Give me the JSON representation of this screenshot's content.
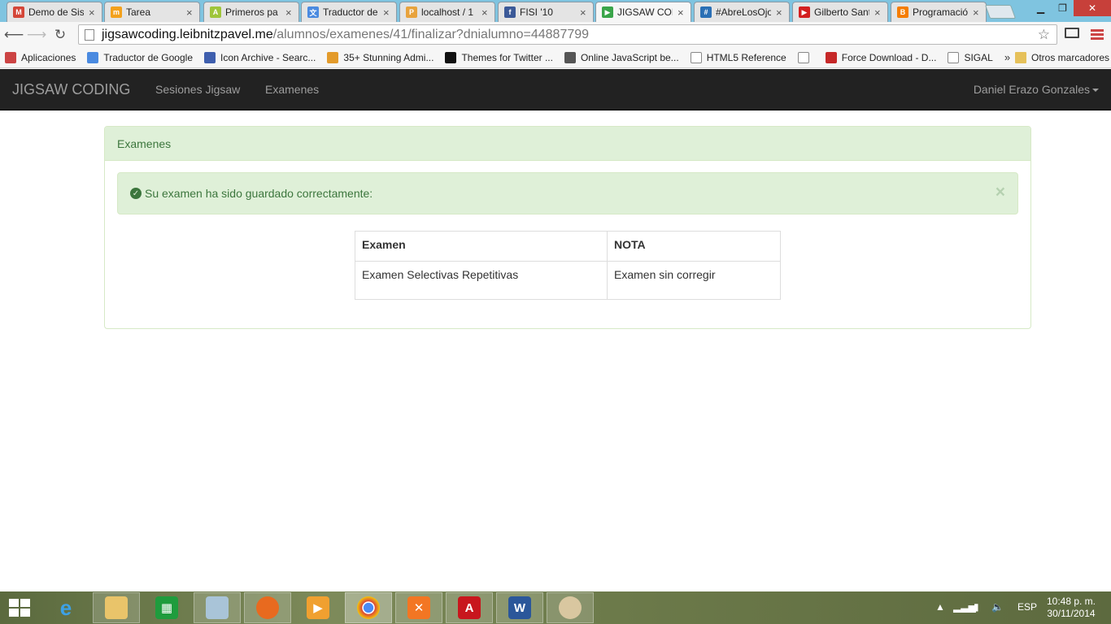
{
  "browser": {
    "tabs": [
      {
        "title": "Demo de Sis",
        "icon": "gmail-icon",
        "color": "#d44638",
        "glyph": "M"
      },
      {
        "title": "Tarea",
        "icon": "moodle-icon",
        "color": "#f3a11c",
        "glyph": "m"
      },
      {
        "title": "Primeros pa",
        "icon": "android-icon",
        "color": "#9fc53a",
        "glyph": "A"
      },
      {
        "title": "Traductor de",
        "icon": "translate-icon",
        "color": "#4a8ae0",
        "glyph": "文"
      },
      {
        "title": "localhost / 1",
        "icon": "phpmyadmin-icon",
        "color": "#e8a33d",
        "glyph": "P"
      },
      {
        "title": "FISI '10",
        "icon": "facebook-icon",
        "color": "#3b5998",
        "glyph": "f"
      },
      {
        "title": "JIGSAW COD",
        "icon": "play-icon",
        "color": "#3aa54a",
        "glyph": "▶"
      },
      {
        "title": "#AbreLosOjo",
        "icon": "web-icon",
        "color": "#2a6fb5",
        "glyph": "#"
      },
      {
        "title": "Gilberto Sant",
        "icon": "youtube-icon",
        "color": "#d32020",
        "glyph": "▶"
      },
      {
        "title": "Programació",
        "icon": "blogger-icon",
        "color": "#f57d00",
        "glyph": "B"
      }
    ],
    "active_tab_index": 6,
    "url": {
      "host": "jigsawcoding.leibnitzpavel.me",
      "path": "/alumnos/examenes/41/finalizar?dnialumno=44887799"
    },
    "bookmarks": [
      {
        "label": "Aplicaciones",
        "icon": "apps-grid-icon",
        "color": "#c44"
      },
      {
        "label": "Traductor de Google",
        "icon": "translate-icon",
        "color": "#4a8ae0"
      },
      {
        "label": "Icon Archive - Searc...",
        "icon": "star-badge-icon",
        "color": "#3f5fae"
      },
      {
        "label": "35+ Stunning Admi...",
        "icon": "tw-icon",
        "color": "#e39b2b"
      },
      {
        "label": "Themes for Twitter ...",
        "icon": "w-icon",
        "color": "#111"
      },
      {
        "label": "Online JavaScript be...",
        "icon": "owl-icon",
        "color": "#555"
      },
      {
        "label": "HTML5 Reference",
        "icon": "page-icon",
        "color": "#fff"
      },
      {
        "label": "",
        "icon": "page-icon",
        "color": "#fff"
      },
      {
        "label": "Force Download - D...",
        "icon": "fd-icon",
        "color": "#c62828"
      },
      {
        "label": "SIGAL",
        "icon": "page-icon",
        "color": "#fff"
      }
    ],
    "more_bookmarks_glyph": "»",
    "other_bookmarks": "Otros marcadores"
  },
  "navbar": {
    "brand": "JIGSAW CODING",
    "links": [
      "Sesiones Jigsaw",
      "Examenes"
    ],
    "user": "Daniel Erazo Gonzales"
  },
  "panel": {
    "heading": "Examenes",
    "alert": "Su examen ha sido guardado correctamente:",
    "table": {
      "headers": [
        "Examen",
        "NOTA"
      ],
      "rows": [
        [
          "Examen Selectivas Repetitivas",
          "Examen sin corregir"
        ]
      ]
    }
  },
  "taskbar": {
    "language": "ESP",
    "time": "10:48 p. m.",
    "date": "30/11/2014"
  }
}
